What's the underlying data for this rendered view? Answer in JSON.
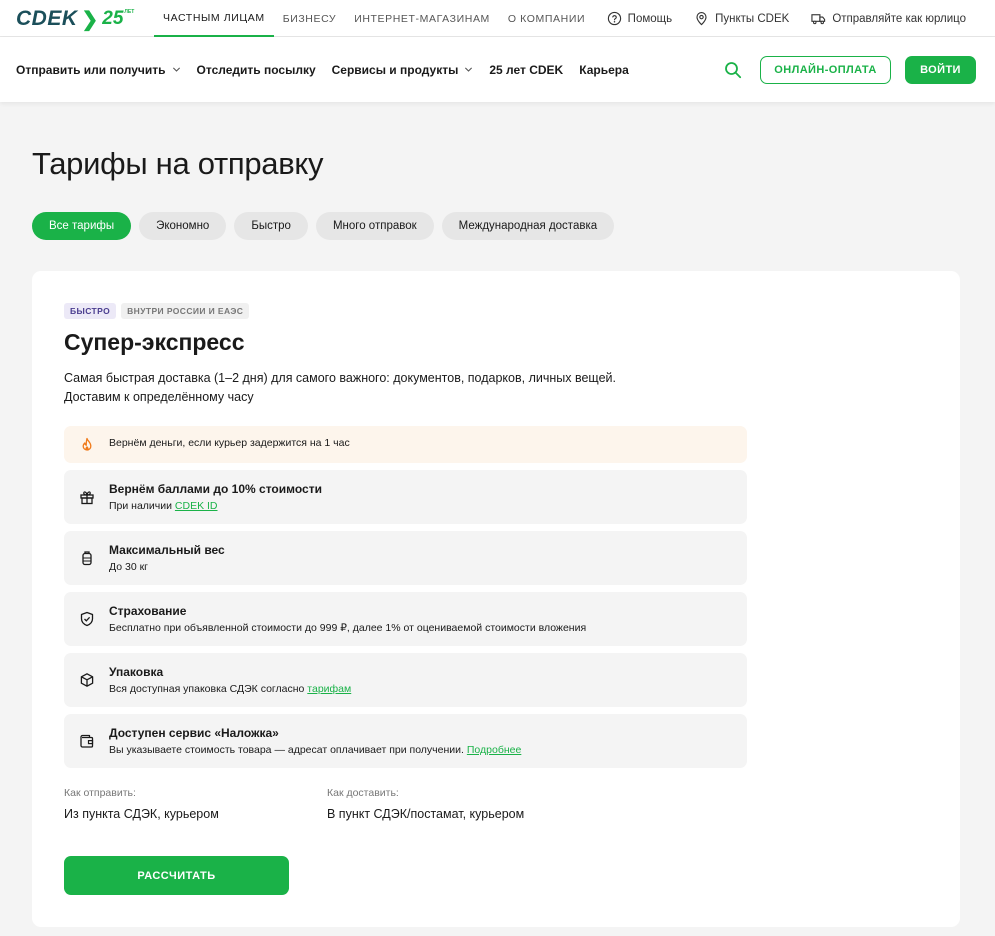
{
  "logo": {
    "brand": "CDEK",
    "anniversary": "25",
    "anniversary_suffix": "ЛЕТ"
  },
  "segments": [
    {
      "label": "ЧАСТНЫМ ЛИЦАМ",
      "active": true
    },
    {
      "label": "БИЗНЕСУ",
      "active": false
    },
    {
      "label": "ИНТЕРНЕТ-МАГАЗИНАМ",
      "active": false
    },
    {
      "label": "О КОМПАНИИ",
      "active": false
    }
  ],
  "top_links": {
    "help": "Помощь",
    "points": "Пункты CDEK",
    "legal": "Отправляйте как юрлицо"
  },
  "nav": {
    "send_receive": "Отправить или получить",
    "track": "Отследить посылку",
    "services": "Сервисы и продукты",
    "anniversary": "25 лет CDEK",
    "career": "Карьера",
    "pay_online": "ОНЛАЙН-ОПЛАТА",
    "login": "ВОЙТИ"
  },
  "page": {
    "title": "Тарифы на отправку",
    "filters": [
      {
        "label": "Все тарифы",
        "active": true
      },
      {
        "label": "Экономно",
        "active": false
      },
      {
        "label": "Быстро",
        "active": false
      },
      {
        "label": "Много отправок",
        "active": false
      },
      {
        "label": "Международная доставка",
        "active": false
      }
    ]
  },
  "tariff": {
    "tags": [
      "БЫСТРО",
      "ВНУТРИ РОССИИ И ЕАЭС"
    ],
    "title": "Супер-экспресс",
    "desc_line1": "Самая быстрая доставка (1–2 дня) для самого важного: документов, подарков, личных вещей.",
    "desc_line2": "Доставим к определённому часу",
    "features": {
      "refund": {
        "title": "Вернём деньги, если курьер задержится на 1 час",
        "icon": "fire-icon"
      },
      "points": {
        "title": "Вернём баллами до 10% стоимости",
        "sub_prefix": "При наличии ",
        "sub_link": "CDEK ID",
        "icon": "gift-icon"
      },
      "weight": {
        "title": "Максимальный вес",
        "sub": "До 30 кг",
        "icon": "weight-icon"
      },
      "insurance": {
        "title": "Страхование",
        "sub": "Бесплатно при объявленной стоимости до 999 ₽, далее 1% от оцениваемой стоимости вложения",
        "icon": "shield-icon"
      },
      "packaging": {
        "title": "Упаковка",
        "sub_prefix": "Вся доступная упаковка СДЭК согласно ",
        "sub_link": "тарифам",
        "icon": "box-icon"
      },
      "cod": {
        "title": "Доступен сервис «Наложка»",
        "sub_prefix": "Вы указываете стоимость товара — адресат оплачивает при получении. ",
        "sub_link": "Подробнее",
        "icon": "wallet-icon"
      }
    },
    "send_label": "Как отправить:",
    "send_value": "Из пункта СДЭК, курьером",
    "deliver_label": "Как доставить:",
    "deliver_value": "В пункт СДЭК/постамат, курьером",
    "calc_button": "РАССЧИТАТЬ"
  },
  "colors": {
    "accent": "#1ab248",
    "brand_dark": "#1b4f5a",
    "warn_bg": "#fdf5ec",
    "fire": "#f07a1a"
  }
}
